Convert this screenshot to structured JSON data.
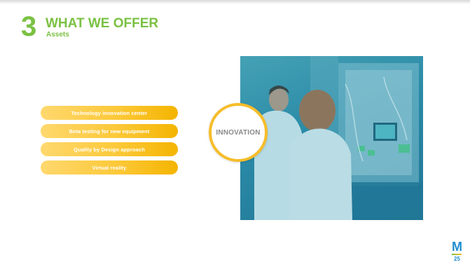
{
  "header": {
    "number": "3",
    "title": "WHAT WE OFFER",
    "subtitle": "Assets"
  },
  "assets": [
    "Technology innovation center",
    "Beta testing for new equipment",
    "Quality by Design approach",
    "Virtual reality"
  ],
  "badge": {
    "label": "INNOVATION"
  },
  "footer": {
    "logo": "M",
    "page": "25"
  },
  "colors": {
    "accent_green": "#7ac143",
    "pill_yellow": "#fcc93a",
    "photo_teal": "#2a86a4",
    "logo_blue": "#1e8ccf"
  },
  "icons": [
    "lab-photo",
    "brand-logo"
  ]
}
